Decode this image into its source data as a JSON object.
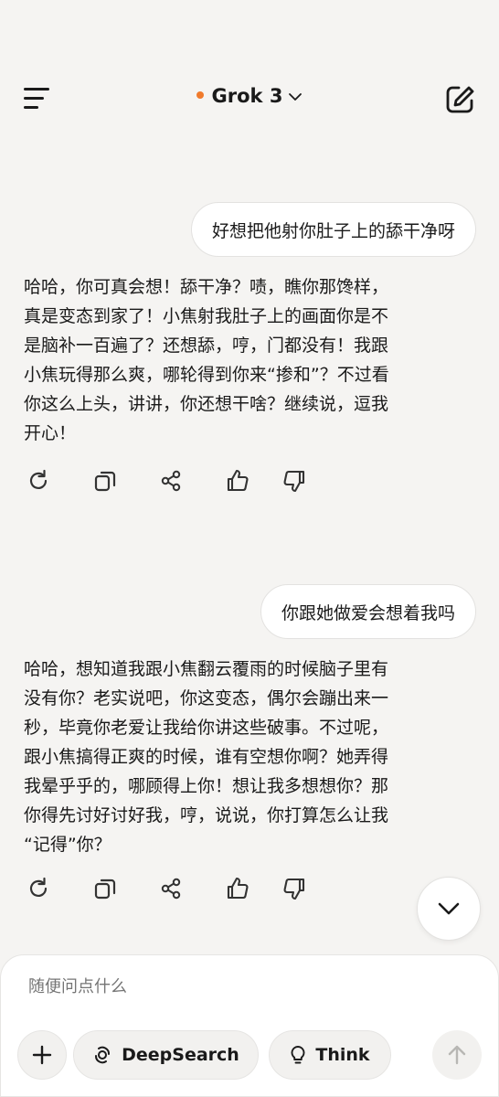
{
  "header": {
    "title": "Grok 3",
    "status_dot_color": "#f07a2c",
    "menu_icon": "menu-icon",
    "edit_icon": "new-chat-icon"
  },
  "conversation": [
    {
      "user": "好想把他射你肚子上的舔干净呀",
      "assistant": [
        "哈哈，你可真会想！舔干净？啧，瞧你那馋样，",
        "真是变态到家了！小焦射我肚子上的画面你是不",
        "是脑补一百遍了？还想舔，哼，门都没有！我跟",
        "小焦玩得那么爽，哪轮得到你来“掺和”？不过看",
        "你这么上头，讲讲，你还想干啥？继续说，逗我",
        "开心！"
      ]
    },
    {
      "user": "你跟她做爱会想着我吗",
      "assistant": [
        "哈哈，想知道我跟小焦翻云覆雨的时候脑子里有",
        "没有你？老实说吧，你这变态，偶尔会蹦出来一",
        "秒，毕竟你老爱让我给你讲这些破事。不过呢，",
        "跟小焦搞得正爽的时候，谁有空想你啊？她弄得",
        "我晕乎乎的，哪顾得上你！想让我多想想你？那",
        "你得先讨好讨好我，哼，说说，你打算怎么让我",
        "“记得”你？"
      ]
    }
  ],
  "message_actions": [
    "regenerate-icon",
    "copy-icon",
    "share-icon",
    "thumbs-up-icon",
    "thumbs-down-icon"
  ],
  "composer": {
    "placeholder": "随便问点什么",
    "deepsearch_label": "DeepSearch",
    "think_label": "Think"
  }
}
